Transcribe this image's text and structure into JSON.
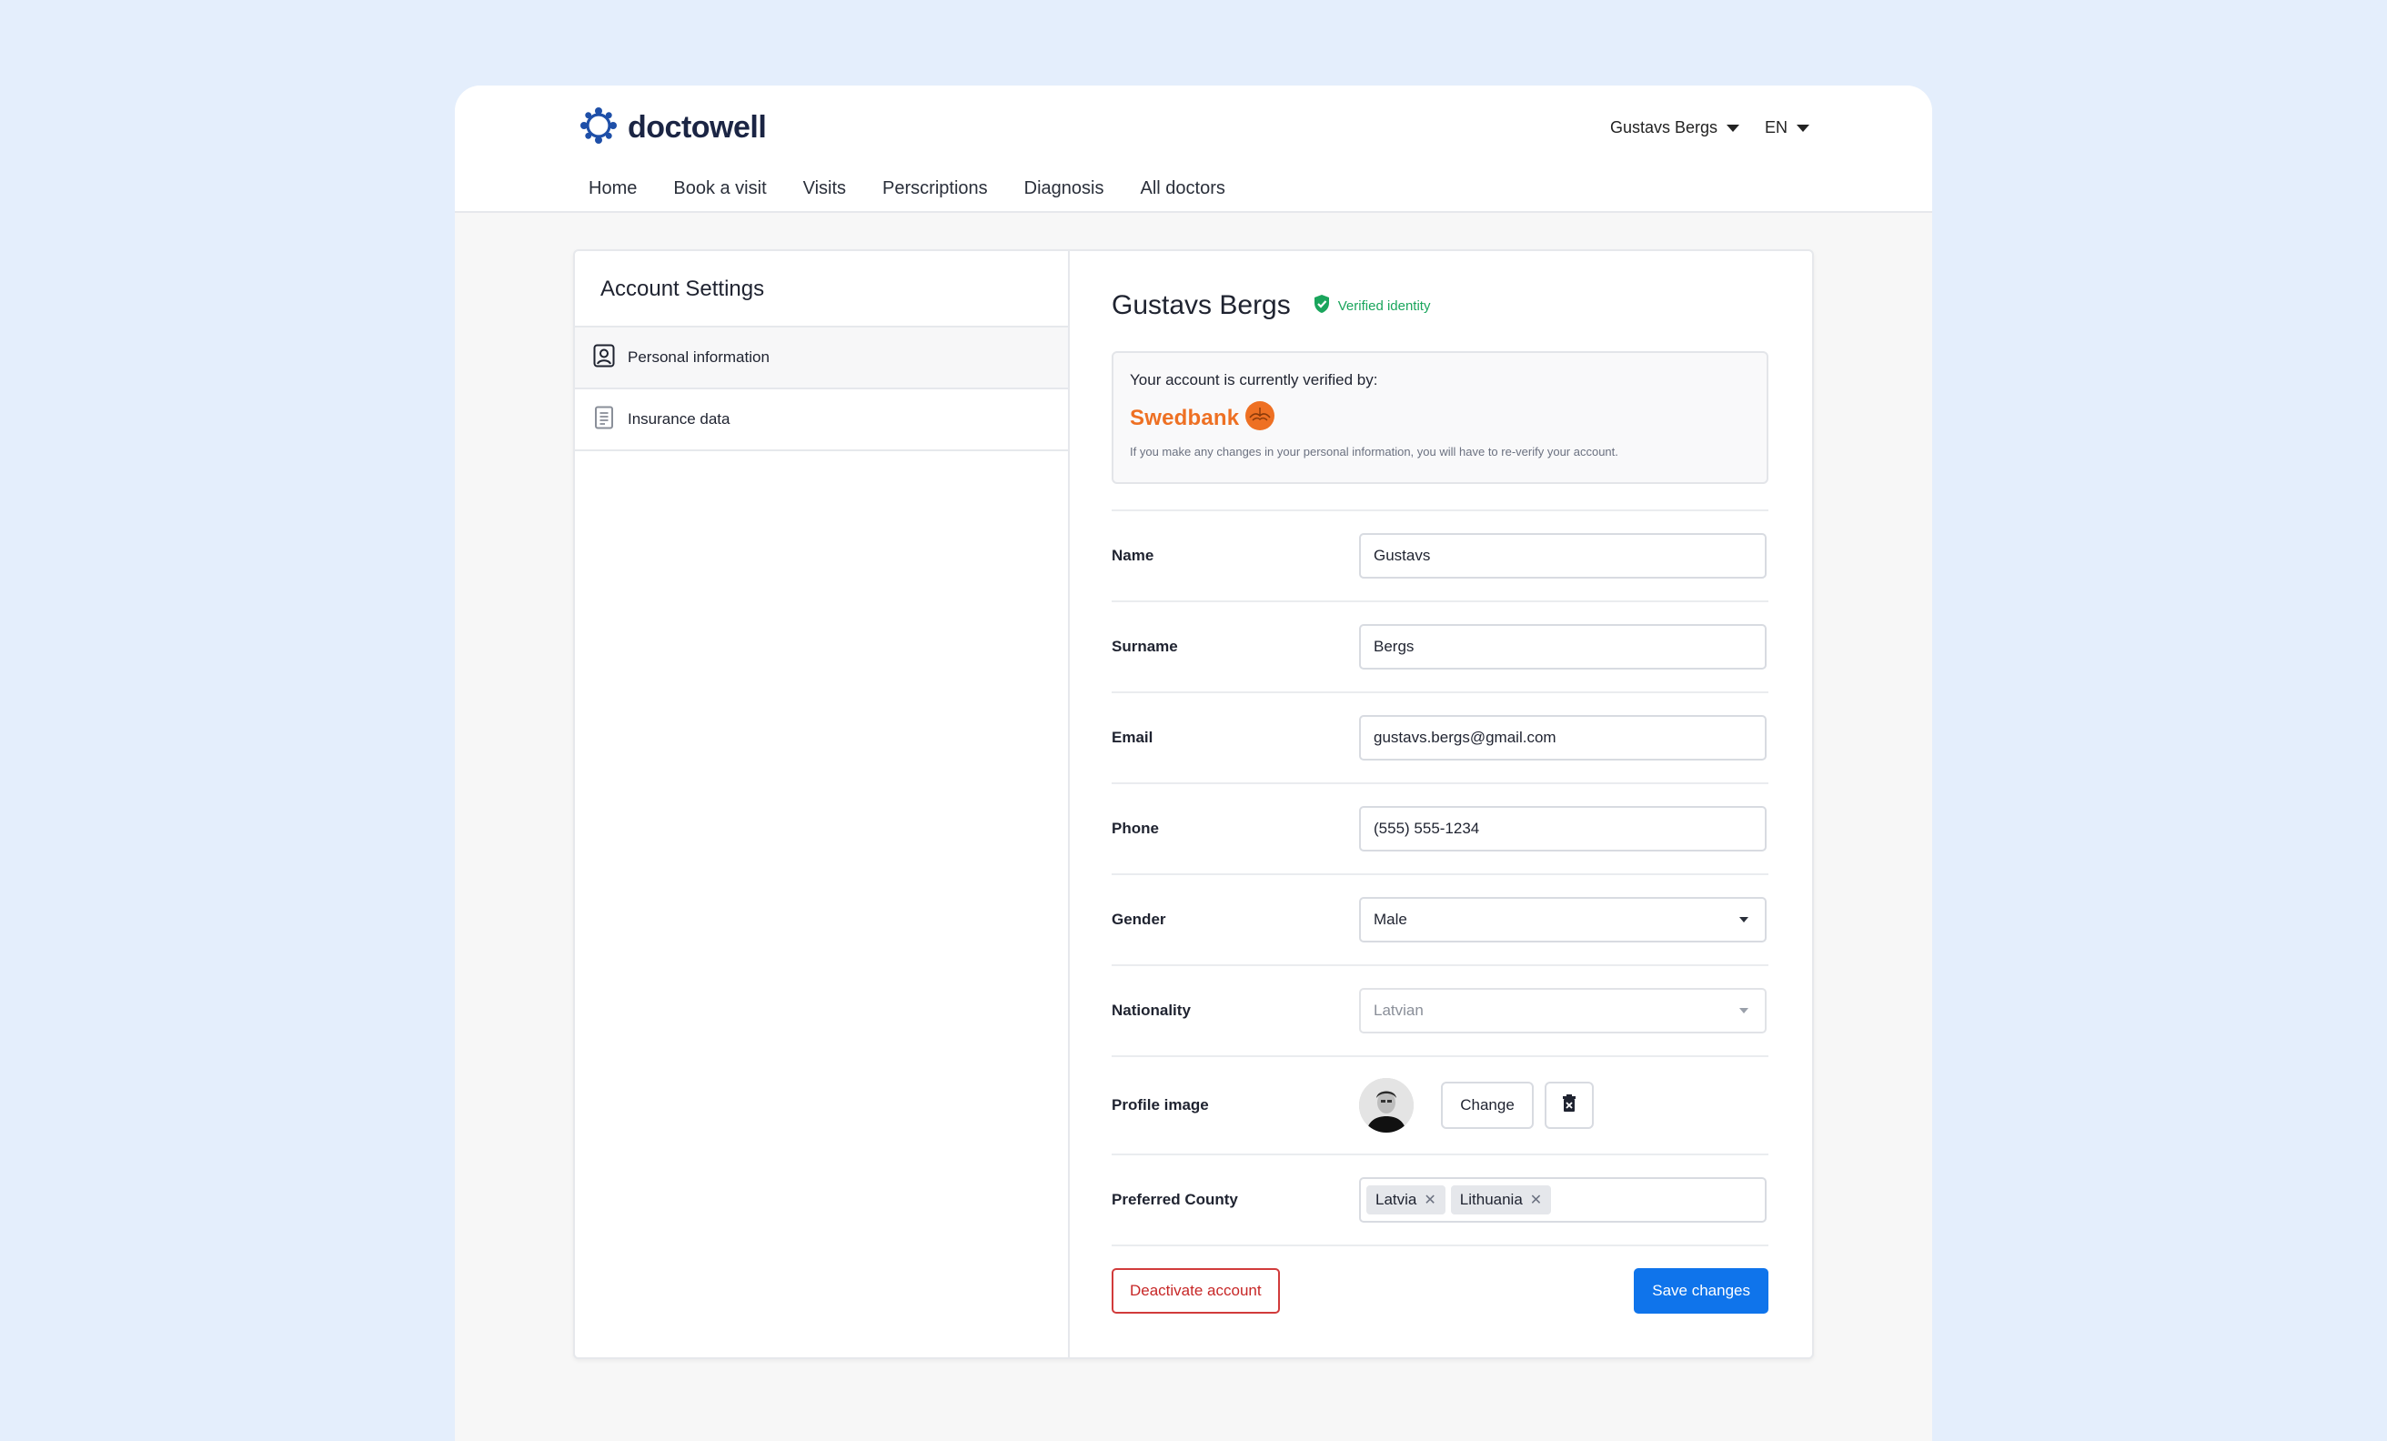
{
  "brand": {
    "name": "doctowell"
  },
  "header": {
    "user_name": "Gustavs Bergs",
    "language": "EN",
    "nav": [
      "Home",
      "Book a visit",
      "Visits",
      "Perscriptions",
      "Diagnosis",
      "All doctors"
    ]
  },
  "sidebar": {
    "title": "Account Settings",
    "items": [
      {
        "label": "Personal information",
        "icon": "user-id-icon",
        "active": true
      },
      {
        "label": "Insurance data",
        "icon": "document-icon",
        "active": false
      }
    ]
  },
  "profile": {
    "name": "Gustavs Bergs",
    "verified_label": "Verified identity"
  },
  "verification": {
    "title": "Your account is currently verified by:",
    "bank": "Swedbank",
    "note": "If you make any changes in your personal information, you will have to re-verify your account."
  },
  "form": {
    "name": {
      "label": "Name",
      "value": "Gustavs"
    },
    "surname": {
      "label": "Surname",
      "value": "Bergs"
    },
    "email": {
      "label": "Email",
      "value": "gustavs.bergs@gmail.com"
    },
    "phone": {
      "label": "Phone",
      "value": "(555) 555-1234"
    },
    "gender": {
      "label": "Gender",
      "value": "Male"
    },
    "nationality": {
      "label": "Nationality",
      "value": "Latvian"
    },
    "profile_image": {
      "label": "Profile image",
      "change_label": "Change"
    },
    "preferred_county": {
      "label": "Preferred County",
      "chips": [
        "Latvia",
        "Lithuania"
      ]
    }
  },
  "actions": {
    "deactivate": "Deactivate account",
    "save": "Save changes"
  },
  "colors": {
    "background": "#e4eefc",
    "primary": "#0f74eb",
    "danger": "#c72727",
    "verified": "#1aa55c",
    "bank": "#ee7023",
    "logo": "#1e4fa8"
  }
}
